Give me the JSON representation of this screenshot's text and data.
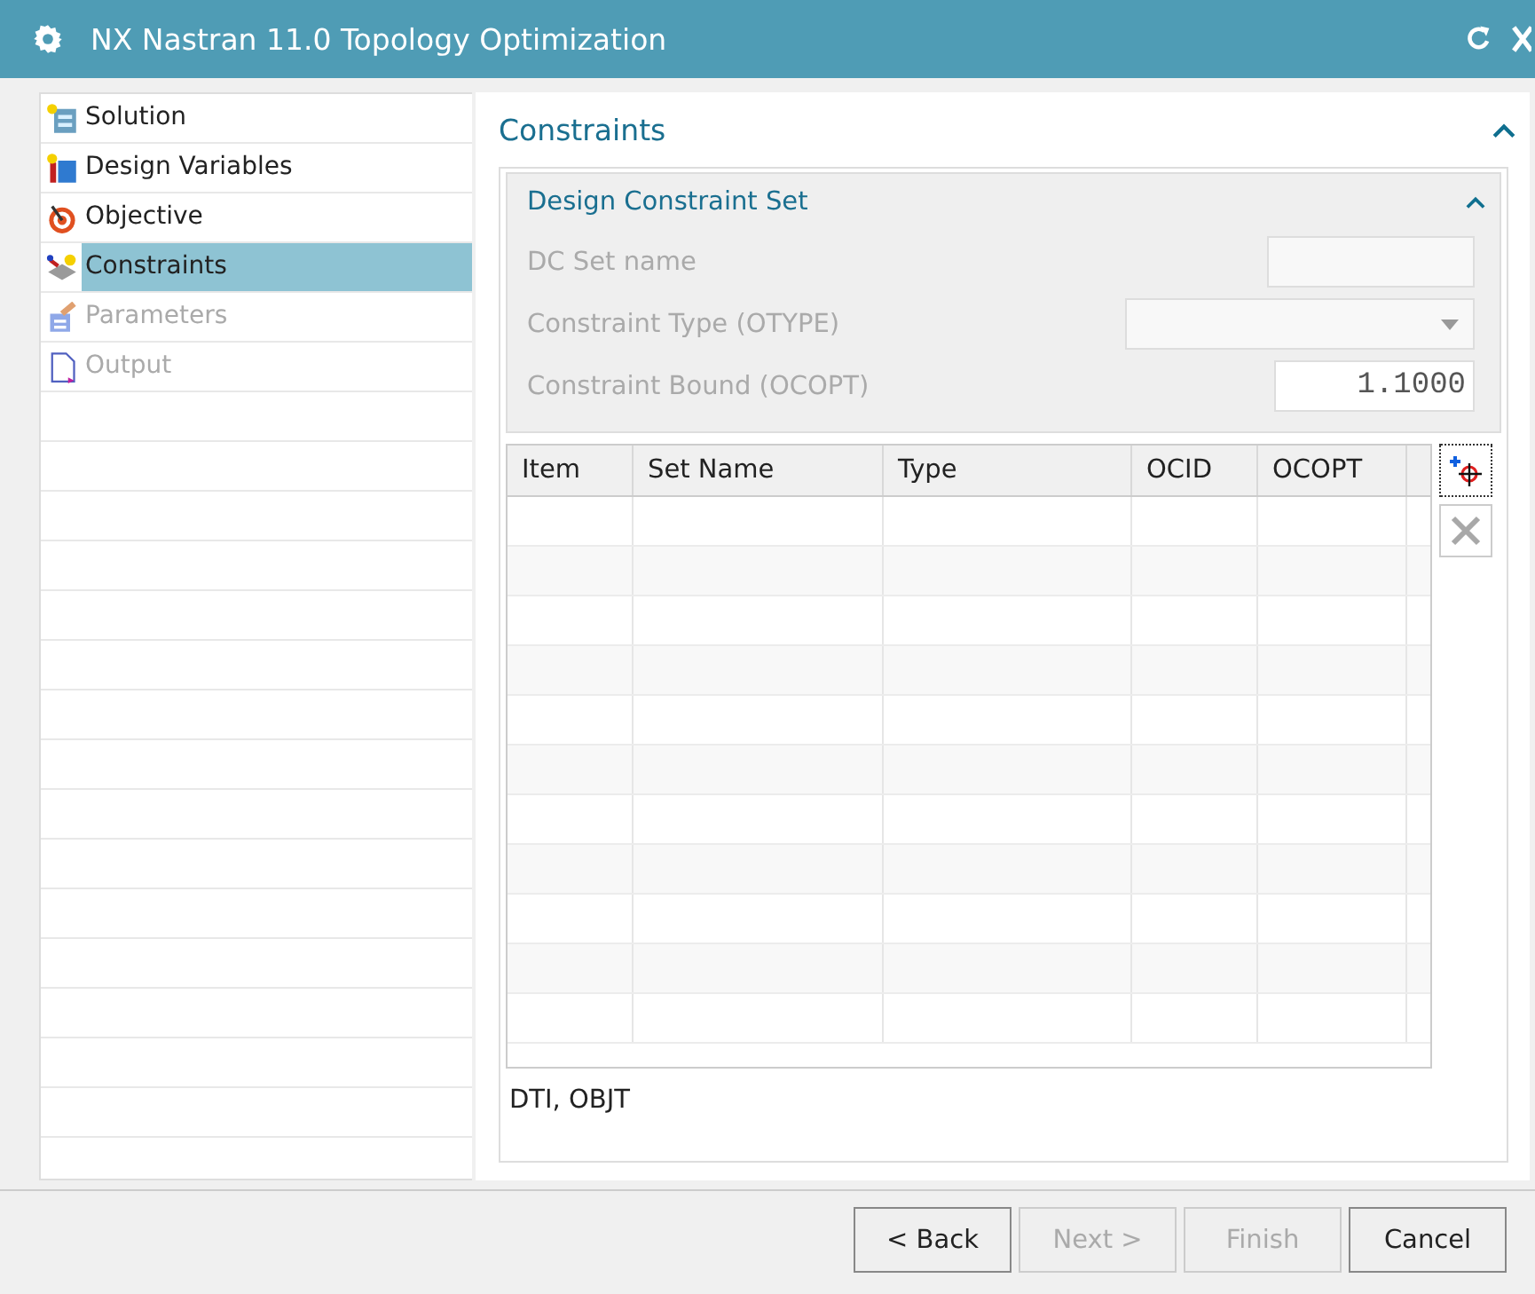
{
  "window": {
    "title": "NX Nastran 11.0 Topology Optimization"
  },
  "sidebar": {
    "items": [
      {
        "label": "Solution",
        "kind": "solution",
        "selected": false,
        "disabled": false
      },
      {
        "label": "Design Variables",
        "kind": "variables",
        "selected": false,
        "disabled": false
      },
      {
        "label": "Objective",
        "kind": "objective",
        "selected": false,
        "disabled": false
      },
      {
        "label": "Constraints",
        "kind": "constraints",
        "selected": true,
        "disabled": false
      },
      {
        "label": "Parameters",
        "kind": "parameters",
        "selected": false,
        "disabled": true
      },
      {
        "label": "Output",
        "kind": "output",
        "selected": false,
        "disabled": true
      }
    ]
  },
  "section": {
    "title": "Constraints",
    "expanded": true,
    "group": {
      "title": "Design Constraint Set",
      "expanded": true,
      "fields": [
        {
          "label": "DC Set name",
          "kind": "text",
          "disabled": true
        },
        {
          "label": "Constraint Type (OTYPE)",
          "kind": "dropdown",
          "disabled": true
        },
        {
          "label": "Constraint Bound (OCOPT)",
          "kind": "number",
          "value": "1.1000",
          "disabled": true
        }
      ]
    },
    "table": {
      "columns": [
        "Item",
        "Set Name",
        "Type",
        "OCID",
        "OCOPT"
      ]
    },
    "note": "DTI, OBJT"
  },
  "buttons": [
    {
      "label": "< Back",
      "disabled": false
    },
    {
      "label": "Next >",
      "disabled": true
    },
    {
      "label": "Finish",
      "disabled": true
    },
    {
      "label": "Cancel",
      "disabled": false
    }
  ]
}
